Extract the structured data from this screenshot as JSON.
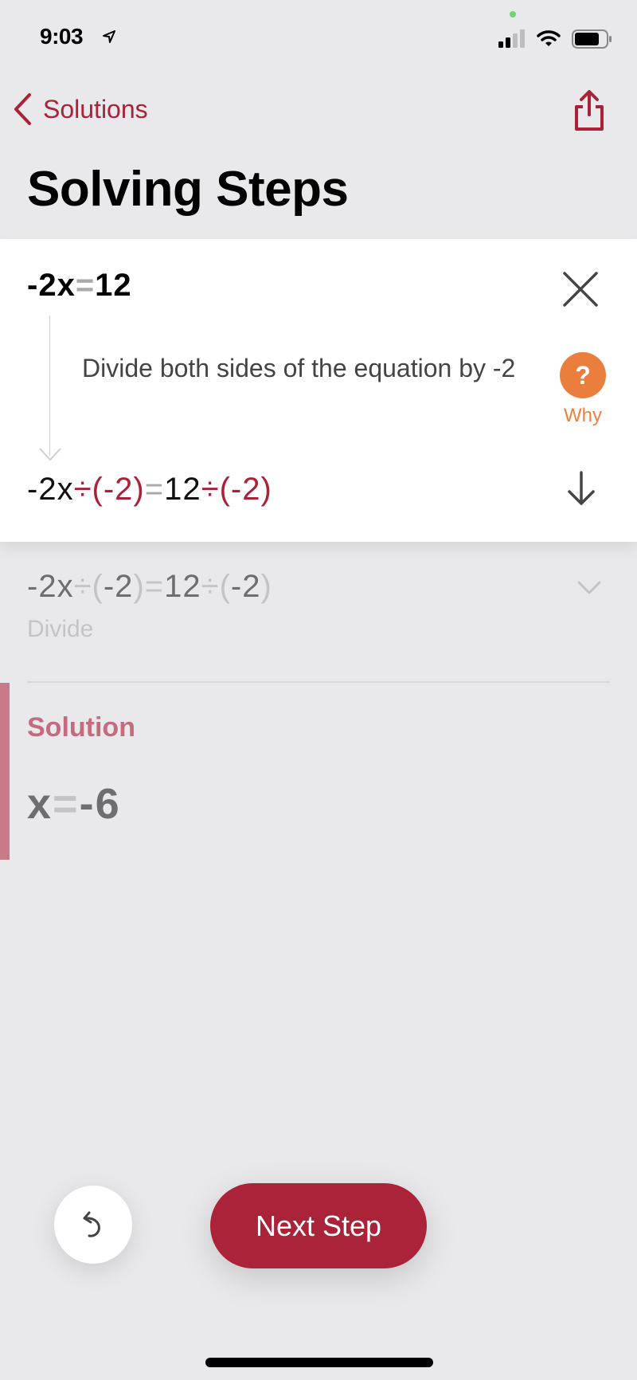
{
  "status_bar": {
    "time": "9:03",
    "icons": [
      "location-arrow-icon",
      "signal-icon",
      "wifi-icon",
      "battery-icon"
    ]
  },
  "nav": {
    "back_label": "Solutions",
    "title": "Solving Steps"
  },
  "current_step": {
    "equation_parts": [
      "-2x",
      "=",
      "12"
    ],
    "description": "Divide both sides of the equation by -2",
    "why_symbol": "?",
    "why_label": "Why",
    "result_parts": {
      "lhs": "-2x",
      "div1": "÷",
      "paren1": "(-2)",
      "eq": "=",
      "rhs": "12",
      "div2": "÷",
      "paren2": "(-2)"
    }
  },
  "previous_step": {
    "equation_parts": {
      "lhs": "-2x",
      "div1": "÷",
      "paren1_open": "(",
      "val1": "-2",
      "paren1_close": ")",
      "eq": "=",
      "rhs": "12",
      "div2": "÷",
      "paren2_open": "(",
      "val2": "-2",
      "paren2_close": ")"
    },
    "label": "Divide"
  },
  "solution": {
    "heading": "Solution",
    "var": "x",
    "eq": "=",
    "value": "-6"
  },
  "actions": {
    "next_step_label": "Next Step"
  },
  "colors": {
    "accent": "#ab2338",
    "why": "#ea7f3d",
    "solution": "#c46b7e"
  }
}
